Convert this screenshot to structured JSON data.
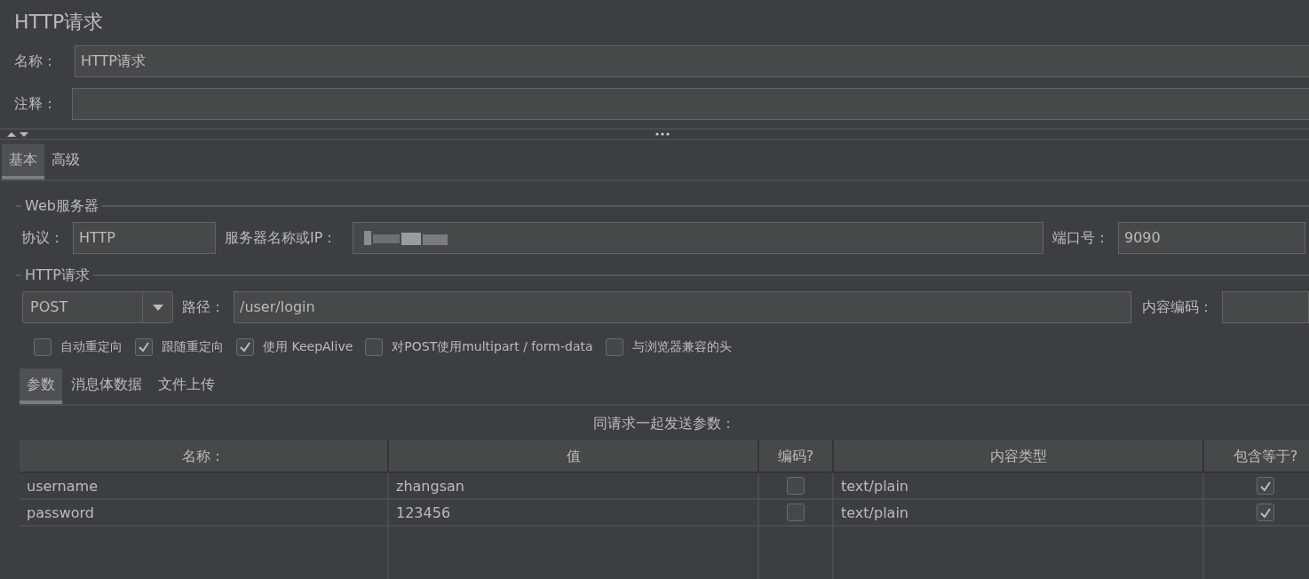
{
  "title": "HTTP请求",
  "name_field": {
    "label": "名称：",
    "value": "HTTP请求"
  },
  "comment_field": {
    "label": "注释："
  },
  "tabs": [
    {
      "label": "基本",
      "selected": true
    },
    {
      "label": "高级",
      "selected": false
    }
  ],
  "web_server": {
    "legend": "Web服务器",
    "protocol_label": "协议：",
    "protocol": "HTTP",
    "server_label": "服务器名称或IP：",
    "port_label": "端口号：",
    "port": "9090"
  },
  "http_request": {
    "legend": "HTTP请求",
    "method": "POST",
    "path_label": "路径：",
    "path": "/user/login",
    "encoding_label": "内容编码："
  },
  "options": [
    {
      "label": "自动重定向",
      "checked": false
    },
    {
      "label": "跟随重定向",
      "checked": true
    },
    {
      "label": "使用 KeepAlive",
      "checked": true
    },
    {
      "label": "对POST使用multipart / form-data",
      "checked": false
    },
    {
      "label": "与浏览器兼容的头",
      "checked": false
    }
  ],
  "sub_tabs": [
    {
      "label": "参数",
      "selected": true
    },
    {
      "label": "消息体数据",
      "selected": false
    },
    {
      "label": "文件上传",
      "selected": false
    }
  ],
  "params_caption": "同请求一起发送参数：",
  "table": {
    "columns": [
      "名称：",
      "值",
      "编码?",
      "内容类型",
      "包含等于?"
    ],
    "rows": [
      {
        "name": "username",
        "value": "zhangsan",
        "encode": false,
        "content_type": "text/plain",
        "include_equals": true
      },
      {
        "name": "password",
        "value": "123456",
        "encode": false,
        "content_type": "text/plain",
        "include_equals": true
      }
    ]
  }
}
